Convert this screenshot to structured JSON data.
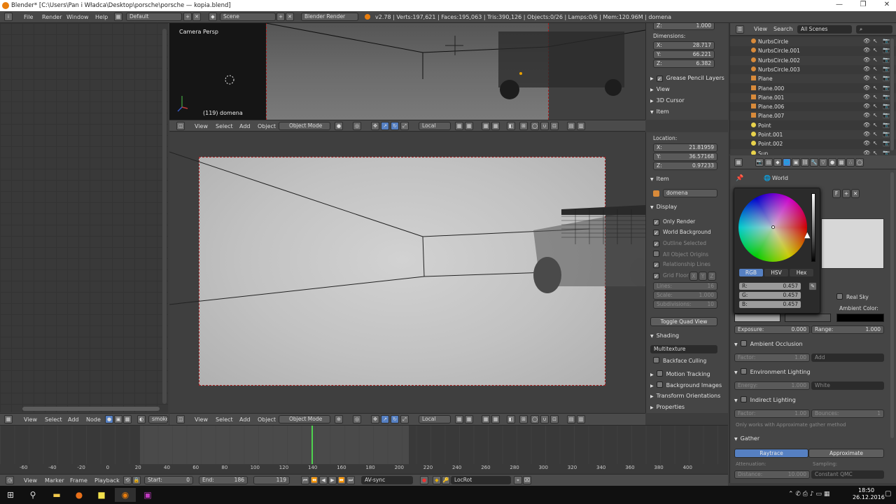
{
  "window": {
    "title": "Blender* [C:\\Users\\Pan i Władca\\Desktop\\porsche\\porsche — kopia.blend]",
    "minimize": "—",
    "maximize": "❐",
    "close": "✕"
  },
  "infobar": {
    "menu": [
      "File",
      "Render",
      "Window",
      "Help"
    ],
    "layout": "Default",
    "scene": "Scene",
    "engine": "Blender Render",
    "stats": "v2.78 | Verts:197,621 | Faces:195,063 | Tris:390,126 | Objects:0/26 | Lamps:0/6 | Mem:120.96M | domena"
  },
  "viewport_top": {
    "label": "Camera Persp",
    "object": "(119) domena",
    "header": {
      "menus": [
        "View",
        "Select",
        "Add",
        "Object"
      ],
      "mode": "Object Mode",
      "pivot": "Local"
    }
  },
  "viewport_main": {
    "header": {
      "menus": [
        "View",
        "Select",
        "Add",
        "Object"
      ],
      "mode": "Object Mode",
      "pivot": "Local"
    }
  },
  "npanel_top": {
    "z_rot": "Z:",
    "z_rot_val": "1.000",
    "dimensions_label": "Dimensions:",
    "dimensions": [
      {
        "axis": "X:",
        "value": "28.717"
      },
      {
        "axis": "Y:",
        "value": "66.221"
      },
      {
        "axis": "Z:",
        "value": "6.382"
      }
    ],
    "sections": [
      "Grease Pencil Layers",
      "View",
      "3D Cursor",
      "Item"
    ]
  },
  "npanel_main": {
    "location_label": "Location:",
    "location": [
      {
        "axis": "X:",
        "value": "21.81959"
      },
      {
        "axis": "Y:",
        "value": "36.57168"
      },
      {
        "axis": "Z:",
        "value": "0.97233"
      }
    ],
    "item_header": "Item",
    "item_name": "domena",
    "display_header": "Display",
    "display_options": [
      {
        "label": "Only Render",
        "checked": true,
        "dim": false
      },
      {
        "label": "World Background",
        "checked": true,
        "dim": false
      },
      {
        "label": "Outline Selected",
        "checked": true,
        "dim": true
      },
      {
        "label": "All Object Origins",
        "checked": false,
        "dim": true
      },
      {
        "label": "Relationship Lines",
        "checked": true,
        "dim": true
      },
      {
        "label": "Grid Floor",
        "checked": true,
        "dim": true
      }
    ],
    "grid_axes": [
      "X",
      "Y",
      "Z"
    ],
    "lines": {
      "label": "Lines:",
      "value": "16"
    },
    "scale": {
      "label": "Scale:",
      "value": "1.000"
    },
    "subdivisions": {
      "label": "Subdivisions:",
      "value": "10"
    },
    "toggle_quad": "Toggle Quad View",
    "shading_header": "Shading",
    "shading_mode": "Multitexture",
    "backface": "Backface Culling",
    "sections": [
      "Motion Tracking",
      "Background Images",
      "Transform Orientations",
      "Properties"
    ]
  },
  "outliner": {
    "menus": [
      "View",
      "Search"
    ],
    "scope": "All Scenes",
    "items": [
      "NurbsCircle",
      "NurbsCircle.001",
      "NurbsCircle.002",
      "NurbsCircle.003",
      "Plane",
      "Plane.000",
      "Plane.001",
      "Plane.006",
      "Plane.007",
      "Point",
      "Point.001",
      "Point.002",
      "Sun"
    ]
  },
  "properties": {
    "context": "World",
    "picker_modes": [
      "RGB",
      "HSV",
      "Hex"
    ],
    "rgb": [
      {
        "label": "R:",
        "value": "0.457"
      },
      {
        "label": "G:",
        "value": "0.457"
      },
      {
        "label": "B:",
        "value": "0.457"
      }
    ],
    "real_sky": "Real Sky",
    "ambient_color": "Ambient Color:",
    "exposure": {
      "label": "Exposure:",
      "value": "0.000"
    },
    "range": {
      "label": "Range:",
      "value": "1.000"
    },
    "ao_header": "Ambient Occlusion",
    "ao_factor": {
      "label": "Factor:",
      "value": "1.00"
    },
    "ao_blend": "Add",
    "env_header": "Environment Lighting",
    "env_energy": {
      "label": "Energy:",
      "value": "1.000"
    },
    "env_color": "White",
    "ind_header": "Indirect Lighting",
    "ind_factor": {
      "label": "Factor:",
      "value": "1.00"
    },
    "ind_bounces": {
      "label": "Bounces:",
      "value": "1"
    },
    "ind_note": "Only works with Approximate gather method",
    "gather_header": "Gather",
    "gather_modes": [
      "Raytrace",
      "Approximate"
    ],
    "attenuation": "Attenuation:",
    "sampling": "Sampling:",
    "distance": {
      "label": "Distance:",
      "value": "10.000"
    },
    "sampling_mode": "Constant QMC",
    "picker_f": "F"
  },
  "node_editor_header": {
    "menus": [
      "View",
      "Select",
      "Add",
      "Node"
    ],
    "material": "smoke"
  },
  "timeline": {
    "ticks": [
      "-60",
      "-40",
      "-20",
      "0",
      "20",
      "40",
      "60",
      "80",
      "100",
      "120",
      "140",
      "160",
      "180",
      "200",
      "220",
      "240",
      "260",
      "280",
      "300",
      "320",
      "340",
      "360",
      "380",
      "400"
    ],
    "current_frame": 119,
    "menus": [
      "View",
      "Marker",
      "Frame",
      "Playback"
    ],
    "start": {
      "label": "Start:",
      "value": "0"
    },
    "end": {
      "label": "End:",
      "value": "186"
    },
    "frame": "119",
    "sync": "AV-sync",
    "keying": "LocRot"
  },
  "taskbar": {
    "time": "18:50",
    "date": "26.12.2016"
  }
}
